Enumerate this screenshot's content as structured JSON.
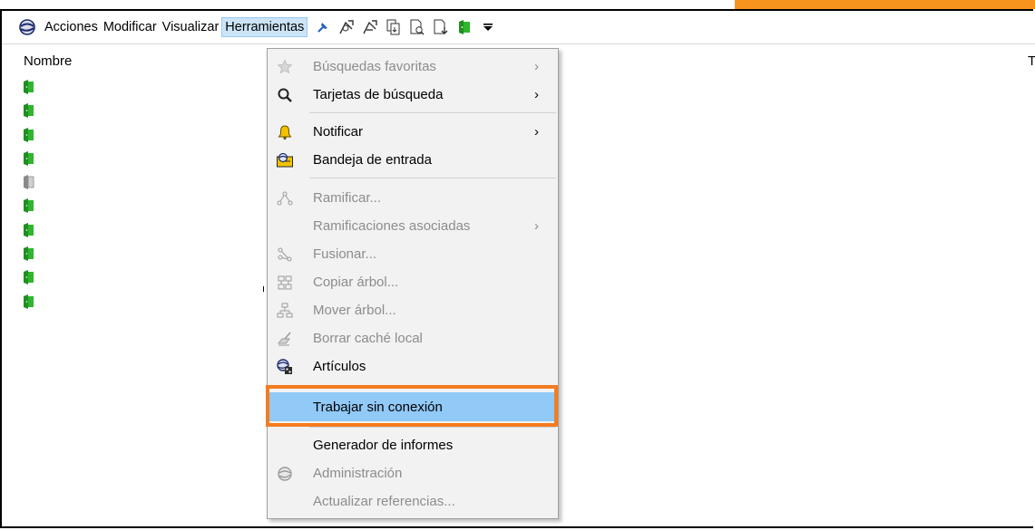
{
  "menubar": {
    "items": [
      {
        "label": "Acciones"
      },
      {
        "label": "Modificar"
      },
      {
        "label": "Visualizar"
      },
      {
        "label": "Herramientas",
        "active": true
      }
    ],
    "toolbar_icons": [
      "pin-icon",
      "draw-arrow-icon",
      "draw-arrow-2-icon",
      "doc-copy-icon",
      "doc-search-icon",
      "doc-download-icon",
      "green-door-icon",
      "dropdown-arrow-icon"
    ]
  },
  "list": {
    "column_header": "Nombre",
    "right_header_cut": "T",
    "items": [
      {
        "icon": "green-door-icon"
      },
      {
        "icon": "green-door-icon"
      },
      {
        "icon": "green-door-icon"
      },
      {
        "icon": "green-door-icon"
      },
      {
        "icon": "gray-door-icon"
      },
      {
        "icon": "green-door-icon"
      },
      {
        "icon": "green-door-icon"
      },
      {
        "icon": "green-door-icon"
      },
      {
        "icon": "green-door-icon"
      },
      {
        "icon": "green-door-icon"
      }
    ]
  },
  "menu": {
    "items": [
      {
        "label": "Búsquedas favoritas",
        "arrow": "›",
        "enabled": false,
        "icon": "star-icon"
      },
      {
        "label": "Tarjetas de búsqueda",
        "arrow": "›",
        "enabled": true,
        "icon": "search-icon"
      },
      {
        "label": "Notificar",
        "arrow": "›",
        "enabled": true,
        "icon": "bell-icon"
      },
      {
        "label": "Bandeja de entrada",
        "arrow": "",
        "enabled": true,
        "icon": "inbox-icon"
      },
      {
        "label": "Ramificar...",
        "arrow": "",
        "enabled": false,
        "icon": "branch-icon"
      },
      {
        "label": "Ramificaciones asociadas",
        "arrow": "›",
        "enabled": false,
        "icon": ""
      },
      {
        "label": "Fusionar...",
        "arrow": "",
        "enabled": false,
        "icon": "merge-icon"
      },
      {
        "label": "Copiar árbol...",
        "arrow": "",
        "enabled": false,
        "icon": "copy-tree-icon"
      },
      {
        "label": "Mover árbol...",
        "arrow": "",
        "enabled": false,
        "icon": "move-tree-icon"
      },
      {
        "label": "Borrar caché local",
        "arrow": "",
        "enabled": false,
        "icon": "clear-cache-icon"
      },
      {
        "label": "Artículos",
        "arrow": "",
        "enabled": true,
        "icon": "articles-icon"
      },
      {
        "label": "Trabajar sin conexión",
        "arrow": "",
        "enabled": true,
        "icon": "",
        "highlighted": true
      },
      {
        "label": "Generador de informes",
        "arrow": "",
        "enabled": true,
        "icon": ""
      },
      {
        "label": "Administración",
        "arrow": "",
        "enabled": false,
        "icon": "admin-icon"
      },
      {
        "label": "Actualizar referencias...",
        "arrow": "",
        "enabled": false,
        "icon": ""
      }
    ]
  },
  "colors": {
    "highlight_bg": "#91c9f7",
    "callout_border": "#f47c20",
    "menu_bg": "#f2f2f2",
    "disabled_text": "#8c8c8c",
    "door_green": "#2fb52f"
  }
}
